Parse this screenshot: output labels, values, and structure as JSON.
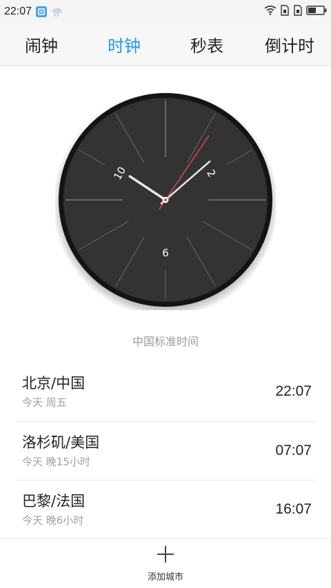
{
  "status_bar": {
    "time": "22:07",
    "icons": [
      "notification-icon",
      "weather-icon",
      "wifi-icon",
      "sim1-icon",
      "sim2-icon",
      "battery-icon"
    ]
  },
  "tabs": [
    {
      "label": "闹钟",
      "active": false
    },
    {
      "label": "时钟",
      "active": true
    },
    {
      "label": "秒表",
      "active": false
    },
    {
      "label": "倒计时",
      "active": false
    }
  ],
  "clock": {
    "numerals": {
      "ten": "10",
      "two": "2",
      "six": "6"
    },
    "hour": 10,
    "minute": 7,
    "second": 4,
    "face_color": "#333333",
    "rim_color": "#141414",
    "second_hand_color": "#e0443c"
  },
  "timezone_label": "中国标准时间",
  "cities": [
    {
      "name": "北京/中国",
      "sub": "今天  周五",
      "time": "22:07"
    },
    {
      "name": "洛杉矶/美国",
      "sub": "今天  晚15小时",
      "time": "07:07"
    },
    {
      "name": "巴黎/法国",
      "sub": "今天  晚6小时",
      "time": "16:07"
    }
  ],
  "bottom": {
    "add_label": "添加城市"
  },
  "accent_color": "#1a9be8"
}
